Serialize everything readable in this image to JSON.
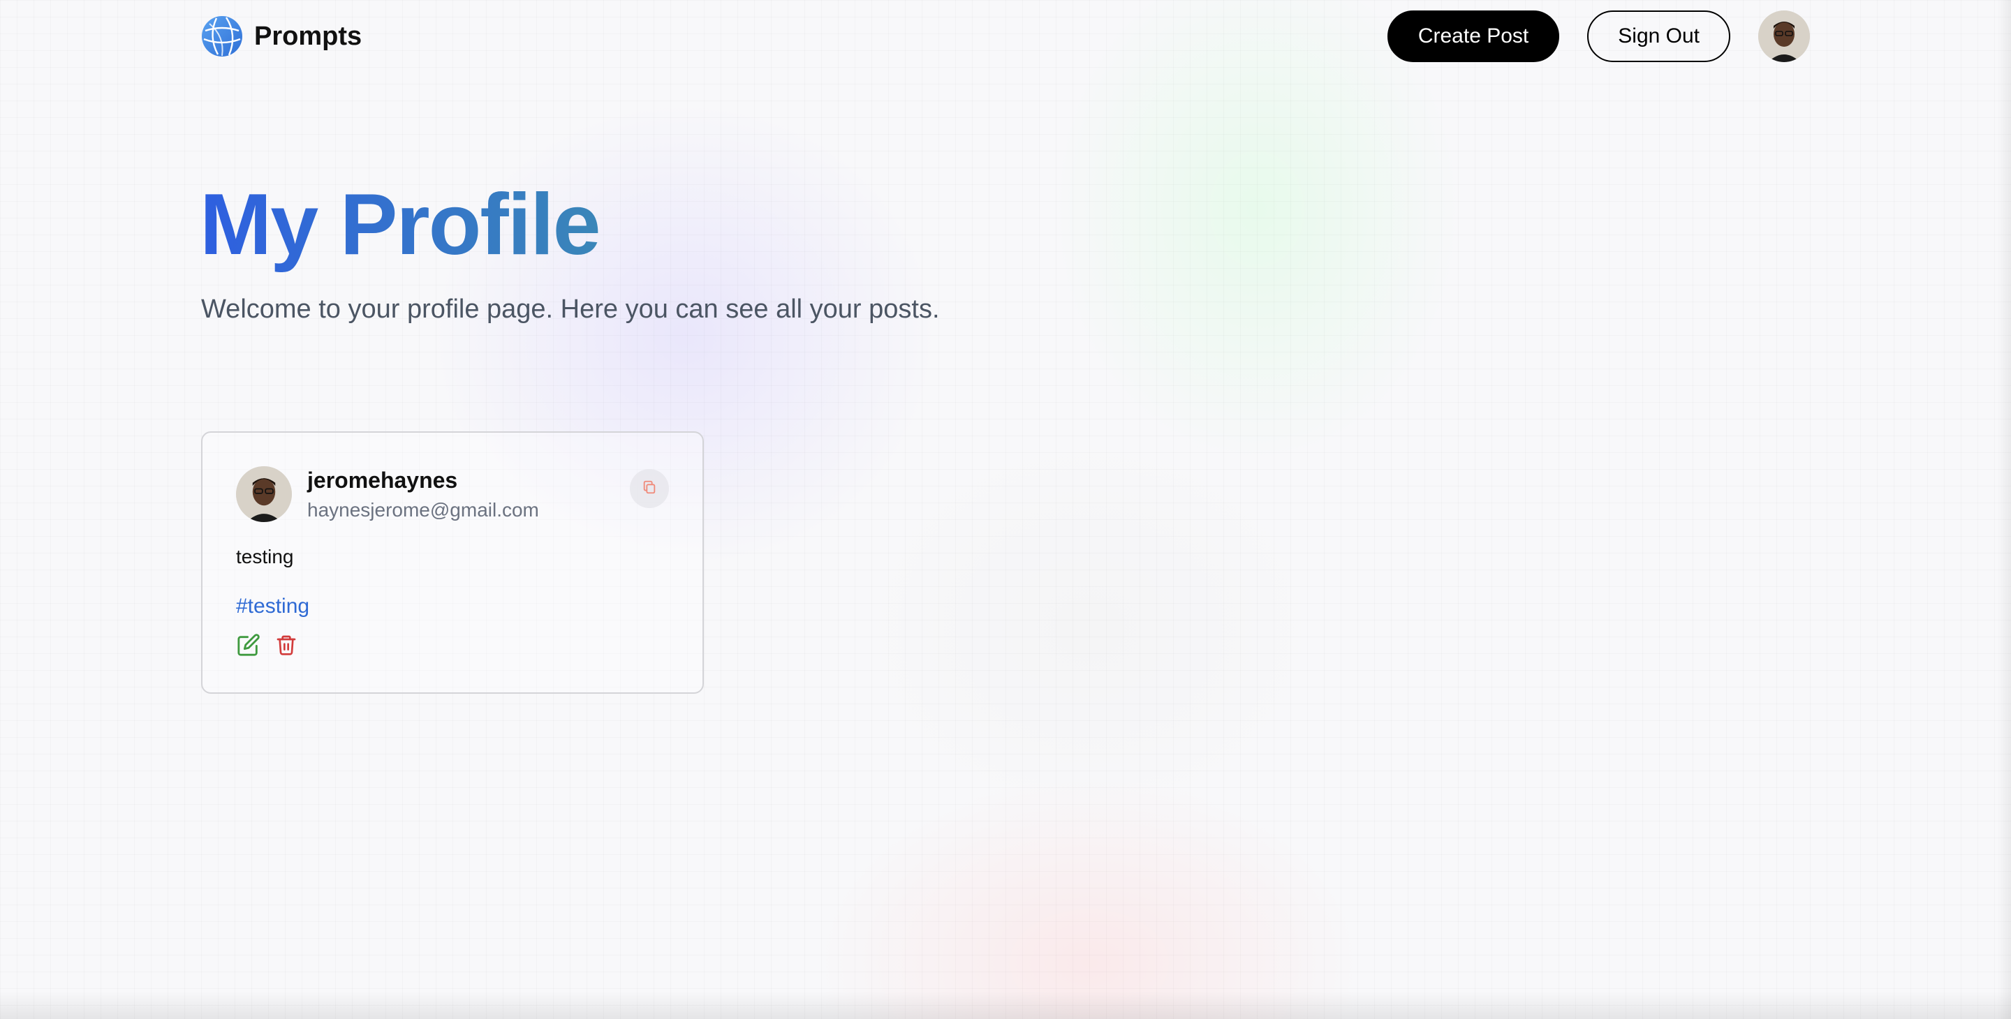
{
  "nav": {
    "brand": "Prompts",
    "create_post": "Create Post",
    "sign_out": "Sign Out"
  },
  "header": {
    "title": "My Profile",
    "subtitle": "Welcome to your profile page. Here you can see all your posts."
  },
  "posts": [
    {
      "username": "jeromehaynes",
      "email": "haynesjerome@gmail.com",
      "prompt": "testing",
      "tag": "#testing"
    }
  ],
  "colors": {
    "title_gradient_start": "#2e5fe0",
    "title_gradient_end": "#3a86b8",
    "tag": "#2f6ad4",
    "edit_icon": "#3f9a3f",
    "delete_icon": "#d23b3b",
    "copy_icon": "#f08a7a"
  },
  "icons": {
    "brand": "globe-icon",
    "copy": "copy-icon",
    "edit": "edit-icon",
    "delete": "trash-icon"
  }
}
